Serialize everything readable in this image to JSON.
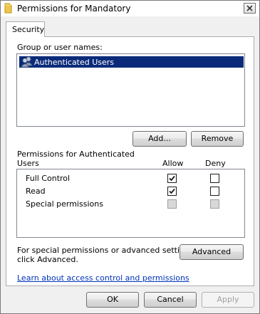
{
  "window": {
    "title": "Permissions for Mandatory",
    "close_label": "Close"
  },
  "tabs": [
    {
      "label": "Security",
      "active": true
    }
  ],
  "group_section": {
    "label": "Group or user names:",
    "items": [
      {
        "name": "Authenticated Users",
        "selected": true,
        "icon": "users-group-icon"
      }
    ],
    "add_button": "Add...",
    "remove_button": "Remove"
  },
  "permissions": {
    "header_line1": "Permissions for Authenticated",
    "header_line2": "Users",
    "allow_header": "Allow",
    "deny_header": "Deny",
    "rows": [
      {
        "name": "Full Control",
        "allow": true,
        "deny": false,
        "disabled": false
      },
      {
        "name": "Read",
        "allow": true,
        "deny": false,
        "disabled": false
      },
      {
        "name": "Special permissions",
        "allow": false,
        "deny": false,
        "disabled": true
      }
    ]
  },
  "advanced": {
    "text_line1": "For special permissions or advanced settings,",
    "text_line2": "click Advanced.",
    "button": "Advanced"
  },
  "learn_link": "Learn about access control and permissions",
  "footer": {
    "ok": "OK",
    "cancel": "Cancel",
    "apply": "Apply",
    "apply_disabled": true
  },
  "colors": {
    "selection": "#0b2b7a",
    "link": "#0033bb",
    "window_bg": "#f0f0f0"
  }
}
